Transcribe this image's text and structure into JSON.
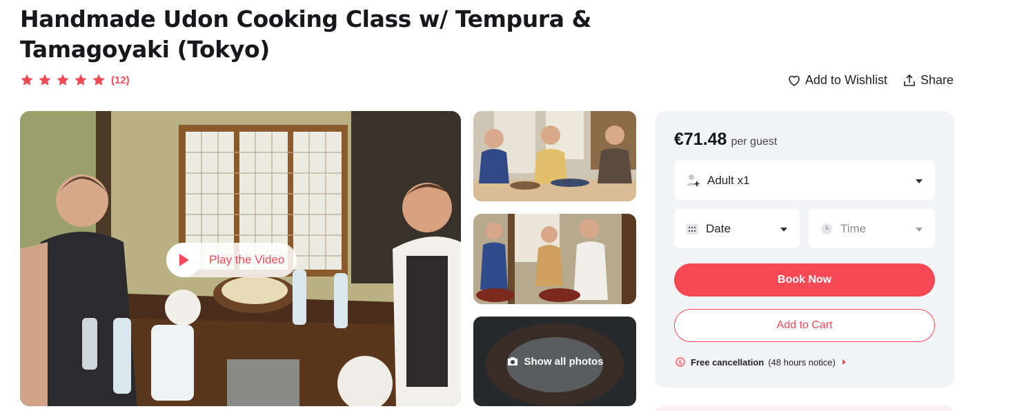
{
  "activity": {
    "title": "Handmade Udon Cooking Class w/ Tempura & Tamagoyaki (Tokyo)",
    "rating_stars": 5,
    "review_count": "(12)"
  },
  "actions": {
    "wishlist_label": "Add to Wishlist",
    "share_label": "Share"
  },
  "gallery": {
    "play_video_label": "Play the Video",
    "show_all_label": "Show all photos"
  },
  "booking": {
    "price": "€71.48",
    "price_unit": "per guest",
    "guests_value": "Adult x1",
    "date_placeholder": "Date",
    "time_placeholder": "Time",
    "book_now_label": "Book Now",
    "add_to_cart_label": "Add to Cart",
    "cancellation_bold": "Free cancellation",
    "cancellation_note": "(48 hours notice)"
  },
  "colors": {
    "accent": "#f54a55",
    "star": "#ef4a56",
    "card_bg": "#f3f4f7"
  },
  "icons": [
    "star-icon",
    "heart-icon",
    "share-icon",
    "play-icon",
    "camera-icon",
    "user-add-icon",
    "calendar-icon",
    "clock-icon",
    "dollar-badge-icon",
    "chevron-down-icon"
  ]
}
